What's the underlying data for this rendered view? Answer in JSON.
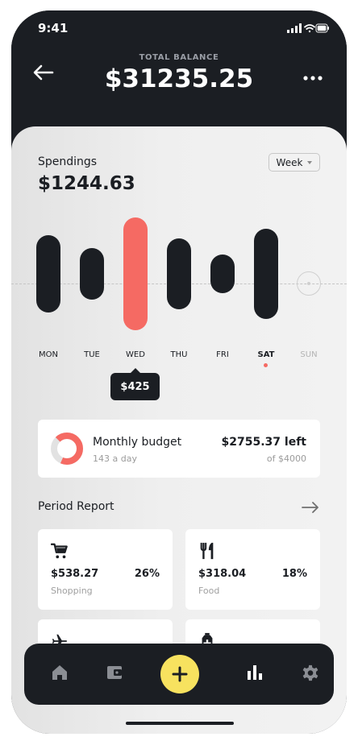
{
  "status_bar": {
    "time": "9:41"
  },
  "header": {
    "balance_label": "TOTAL BALANCE",
    "balance": "$31235.25"
  },
  "spendings": {
    "title": "Spendings",
    "amount": "$1244.63",
    "period_select": "Week",
    "selected_day": "WED",
    "selected_value": "$425",
    "days": [
      {
        "label": "MON"
      },
      {
        "label": "TUE"
      },
      {
        "label": "WED"
      },
      {
        "label": "THU"
      },
      {
        "label": "FRI"
      },
      {
        "label": "SAT"
      },
      {
        "label": "SUN"
      }
    ]
  },
  "budget": {
    "title": "Monthly budget",
    "per_day": "143 a day",
    "left": "$2755.37 left",
    "of_total": "of $4000",
    "spent_fraction": 0.31
  },
  "period_report": {
    "title": "Period Report",
    "categories": [
      {
        "name": "Shopping",
        "amount": "$538.27",
        "percent": "26%",
        "icon": "cart-icon"
      },
      {
        "name": "Food",
        "amount": "$318.04",
        "percent": "18%",
        "icon": "fork-knife-icon"
      },
      {
        "icon": "airplane-icon"
      },
      {
        "icon": "medicine-bottle-icon"
      }
    ]
  },
  "tab_bar": {
    "items": [
      "home-icon",
      "wallet-icon",
      "add-icon",
      "stats-icon",
      "settings-icon"
    ],
    "fab_color": "#f7e25f"
  },
  "colors": {
    "dark": "#1b1e23",
    "accent": "#f56a63"
  }
}
